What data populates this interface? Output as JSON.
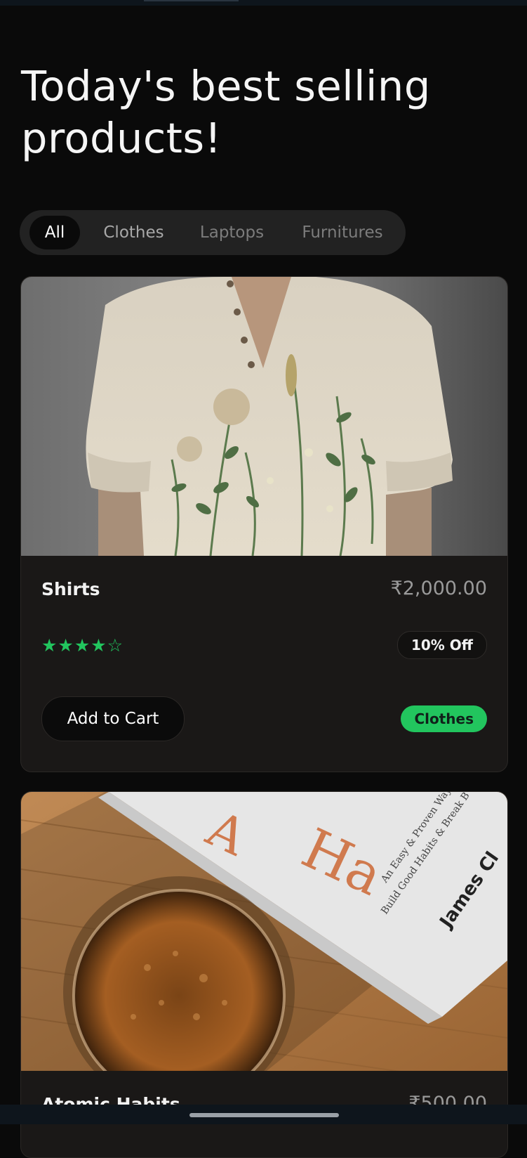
{
  "page": {
    "title": "Today's best selling products!"
  },
  "filters": {
    "tabs": [
      {
        "label": "All",
        "active": true
      },
      {
        "label": "Clothes",
        "active": false
      },
      {
        "label": "Laptops",
        "active": false
      },
      {
        "label": "Furnitures",
        "active": false
      }
    ]
  },
  "products": [
    {
      "name": "Shirts",
      "price": "₹2,000.00",
      "rating": {
        "value": 4,
        "max": 5,
        "display": "★★★★☆"
      },
      "discount": "10% Off",
      "add_to_cart_label": "Add to Cart",
      "category": "Clothes"
    },
    {
      "name": "Atomic Habits",
      "price": "₹500.00",
      "image_text": {
        "title_fragment": "At… Hab",
        "subtitle_line1": "An Easy & Proven Way",
        "subtitle_line2": "Build Good Habits & Break B",
        "author": "James Cl"
      }
    }
  ],
  "colors": {
    "background": "#0a0a0a",
    "card": "#1a1817",
    "accent_green": "#22c55e",
    "tab_bar": "#222222",
    "muted_text": "#9a9a9a"
  }
}
